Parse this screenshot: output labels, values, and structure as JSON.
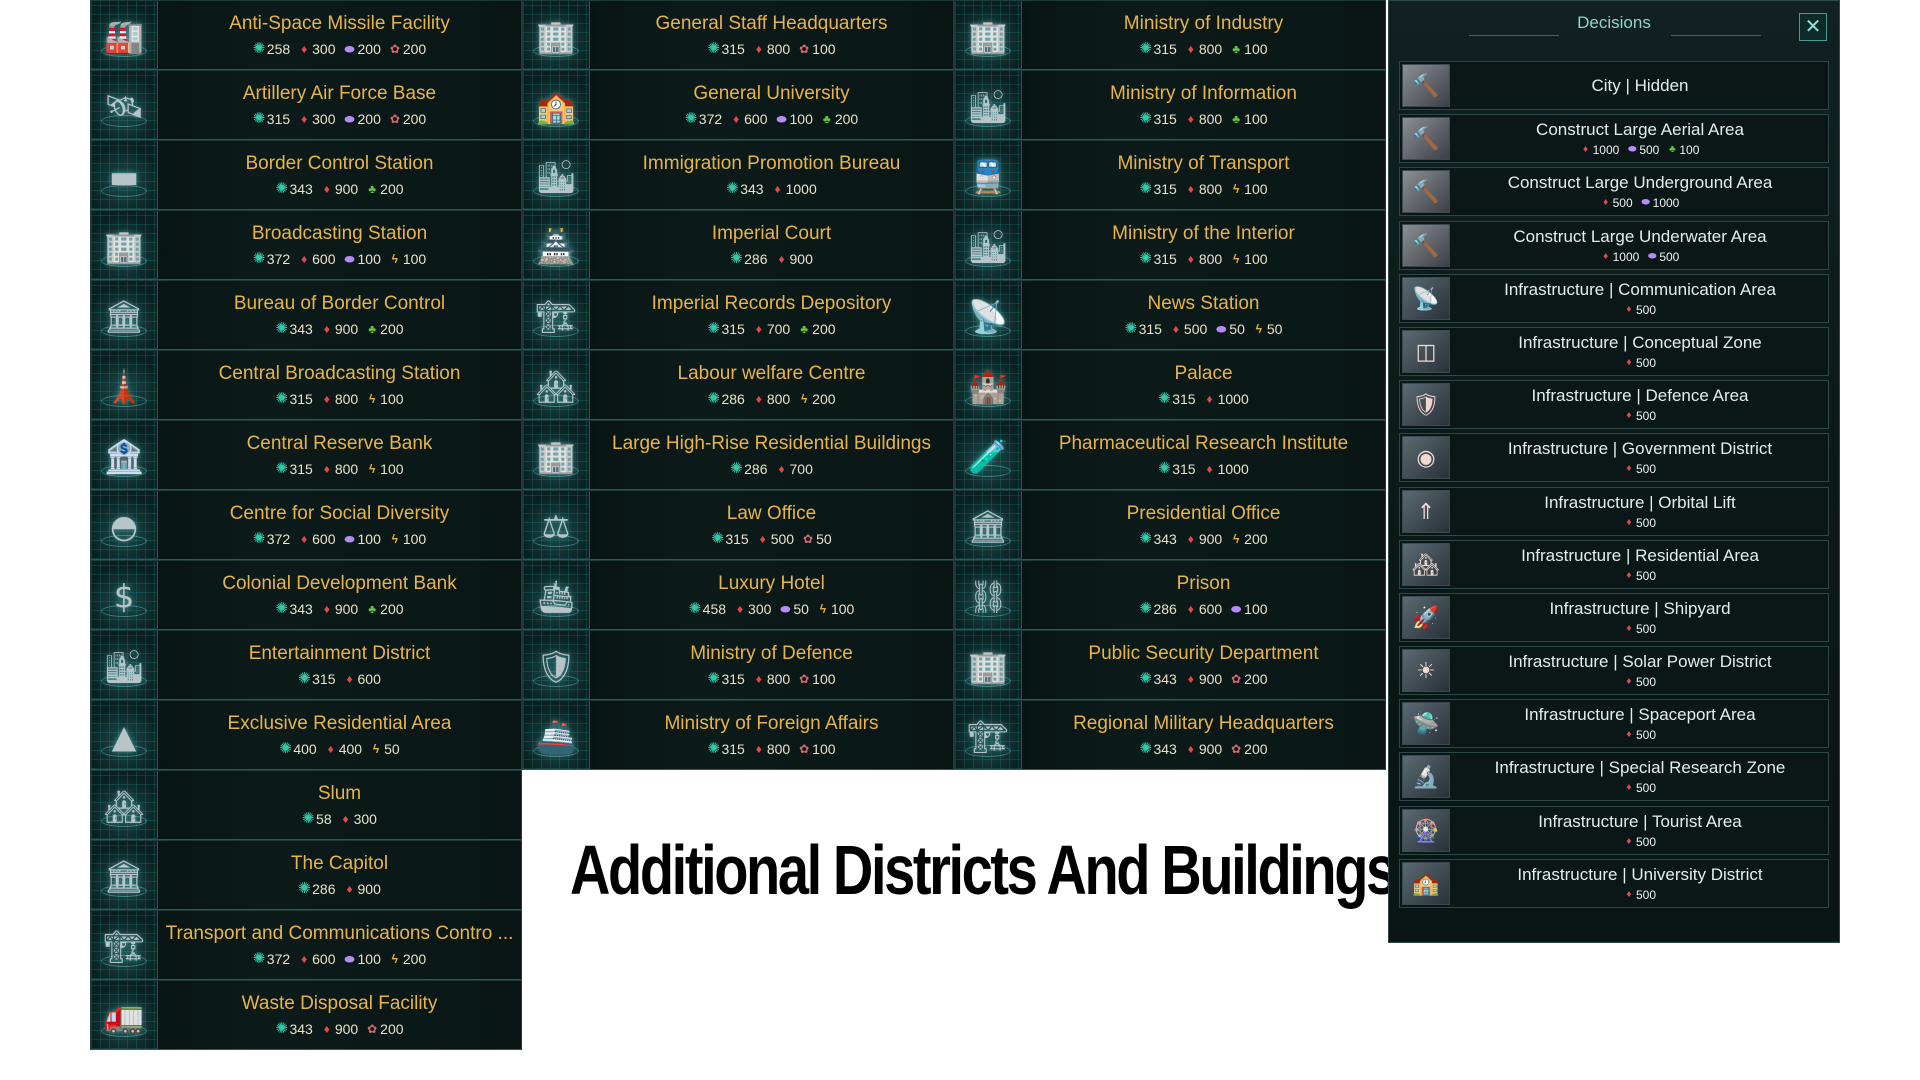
{
  "caption": "Additional Districts And Buildings [JP]",
  "icons": {
    "time": "✺",
    "minerals": "♦",
    "alloys": "⬬",
    "consumer": "✿",
    "food": "♣",
    "energy": "ϟ"
  },
  "columns": [
    [
      {
        "name": "Anti-Space Missile Facility",
        "icon": "factory-icon",
        "glyph": "🏭",
        "costs": [
          [
            "time",
            "258"
          ],
          [
            "minerals",
            "300"
          ],
          [
            "alloys",
            "200"
          ],
          [
            "consumer",
            "200"
          ]
        ]
      },
      {
        "name": "Artillery Air Force Base",
        "icon": "base-icon",
        "glyph": "🛰",
        "costs": [
          [
            "time",
            "315"
          ],
          [
            "minerals",
            "300"
          ],
          [
            "alloys",
            "200"
          ],
          [
            "consumer",
            "200"
          ]
        ]
      },
      {
        "name": "Border Control Station",
        "icon": "station-icon",
        "glyph": "▬",
        "costs": [
          [
            "time",
            "343"
          ],
          [
            "minerals",
            "900"
          ],
          [
            "food",
            "200"
          ]
        ]
      },
      {
        "name": "Broadcasting Station",
        "icon": "broadcast-icon",
        "glyph": "🏢",
        "costs": [
          [
            "time",
            "372"
          ],
          [
            "minerals",
            "600"
          ],
          [
            "alloys",
            "100"
          ],
          [
            "energy",
            "100"
          ]
        ]
      },
      {
        "name": "Bureau of Border Control",
        "icon": "bureau-icon",
        "glyph": "🏛",
        "costs": [
          [
            "time",
            "343"
          ],
          [
            "minerals",
            "900"
          ],
          [
            "food",
            "200"
          ]
        ]
      },
      {
        "name": "Central Broadcasting Station",
        "icon": "tower-icon",
        "glyph": "🗼",
        "costs": [
          [
            "time",
            "315"
          ],
          [
            "minerals",
            "800"
          ],
          [
            "energy",
            "100"
          ]
        ]
      },
      {
        "name": "Central Reserve Bank",
        "icon": "bank-icon",
        "glyph": "🏦",
        "costs": [
          [
            "time",
            "315"
          ],
          [
            "minerals",
            "800"
          ],
          [
            "energy",
            "100"
          ]
        ]
      },
      {
        "name": "Centre for Social Diversity",
        "icon": "dome-icon",
        "glyph": "◓",
        "costs": [
          [
            "time",
            "372"
          ],
          [
            "minerals",
            "600"
          ],
          [
            "alloys",
            "100"
          ],
          [
            "energy",
            "100"
          ]
        ]
      },
      {
        "name": "Colonial Development Bank",
        "icon": "dollar-icon",
        "glyph": "$",
        "costs": [
          [
            "time",
            "343"
          ],
          [
            "minerals",
            "900"
          ],
          [
            "food",
            "200"
          ]
        ]
      },
      {
        "name": "Entertainment District",
        "icon": "city-icon",
        "glyph": "🏙",
        "costs": [
          [
            "time",
            "315"
          ],
          [
            "minerals",
            "600"
          ]
        ]
      },
      {
        "name": "Exclusive Residential Area",
        "icon": "towers-icon",
        "glyph": "▲",
        "costs": [
          [
            "time",
            "400"
          ],
          [
            "minerals",
            "400"
          ],
          [
            "energy",
            "50"
          ]
        ]
      },
      {
        "name": "Slum",
        "icon": "slum-icon",
        "glyph": "🏘",
        "costs": [
          [
            "time",
            "58"
          ],
          [
            "minerals",
            "300"
          ]
        ]
      },
      {
        "name": "The Capitol",
        "icon": "capitol-icon",
        "glyph": "🏛",
        "costs": [
          [
            "time",
            "286"
          ],
          [
            "minerals",
            "900"
          ]
        ]
      },
      {
        "name": "Transport and Communications Contro ...",
        "icon": "transport-icon",
        "glyph": "🏗",
        "costs": [
          [
            "time",
            "372"
          ],
          [
            "minerals",
            "600"
          ],
          [
            "alloys",
            "100"
          ],
          [
            "energy",
            "200"
          ]
        ]
      },
      {
        "name": "Waste Disposal Facility",
        "icon": "waste-icon",
        "glyph": "🚛",
        "costs": [
          [
            "time",
            "343"
          ],
          [
            "minerals",
            "900"
          ],
          [
            "consumer",
            "200"
          ]
        ]
      }
    ],
    [
      {
        "name": "General Staff Headquarters",
        "icon": "hq-icon",
        "glyph": "🏢",
        "costs": [
          [
            "time",
            "315"
          ],
          [
            "minerals",
            "800"
          ],
          [
            "consumer",
            "100"
          ]
        ]
      },
      {
        "name": "General University",
        "icon": "university-icon",
        "glyph": "🏫",
        "costs": [
          [
            "time",
            "372"
          ],
          [
            "minerals",
            "600"
          ],
          [
            "alloys",
            "100"
          ],
          [
            "food",
            "200"
          ]
        ]
      },
      {
        "name": "Immigration Promotion Bureau",
        "icon": "bureau-icon",
        "glyph": "🏙",
        "costs": [
          [
            "time",
            "343"
          ],
          [
            "minerals",
            "1000"
          ]
        ]
      },
      {
        "name": "Imperial Court",
        "icon": "court-icon",
        "glyph": "🏯",
        "costs": [
          [
            "time",
            "286"
          ],
          [
            "minerals",
            "900"
          ]
        ]
      },
      {
        "name": "Imperial Records Depository",
        "icon": "depository-icon",
        "glyph": "🏗",
        "costs": [
          [
            "time",
            "315"
          ],
          [
            "minerals",
            "700"
          ],
          [
            "food",
            "200"
          ]
        ]
      },
      {
        "name": "Labour welfare Centre",
        "icon": "welfare-icon",
        "glyph": "🏘",
        "costs": [
          [
            "time",
            "286"
          ],
          [
            "minerals",
            "800"
          ],
          [
            "energy",
            "200"
          ]
        ]
      },
      {
        "name": "Large High-Rise Residential Buildings",
        "icon": "highrise-icon",
        "glyph": "🏢",
        "costs": [
          [
            "time",
            "286"
          ],
          [
            "minerals",
            "700"
          ]
        ]
      },
      {
        "name": "Law Office",
        "icon": "law-icon",
        "glyph": "⚖",
        "costs": [
          [
            "time",
            "315"
          ],
          [
            "minerals",
            "500"
          ],
          [
            "consumer",
            "50"
          ]
        ]
      },
      {
        "name": "Luxury Hotel",
        "icon": "hotel-icon",
        "glyph": "🛳",
        "costs": [
          [
            "time",
            "458"
          ],
          [
            "minerals",
            "300"
          ],
          [
            "alloys",
            "50"
          ],
          [
            "energy",
            "100"
          ]
        ]
      },
      {
        "name": "Ministry of Defence",
        "icon": "defence-icon",
        "glyph": "🛡",
        "costs": [
          [
            "time",
            "315"
          ],
          [
            "minerals",
            "800"
          ],
          [
            "consumer",
            "100"
          ]
        ]
      },
      {
        "name": "Ministry of Foreign Affairs",
        "icon": "foreign-icon",
        "glyph": "🚢",
        "costs": [
          [
            "time",
            "315"
          ],
          [
            "minerals",
            "800"
          ],
          [
            "consumer",
            "100"
          ]
        ]
      }
    ],
    [
      {
        "name": "Ministry of Industry",
        "icon": "industry-icon",
        "glyph": "🏢",
        "costs": [
          [
            "time",
            "315"
          ],
          [
            "minerals",
            "800"
          ],
          [
            "food",
            "100"
          ]
        ]
      },
      {
        "name": "Ministry of Information",
        "icon": "information-icon",
        "glyph": "🏙",
        "costs": [
          [
            "time",
            "315"
          ],
          [
            "minerals",
            "800"
          ],
          [
            "food",
            "100"
          ]
        ]
      },
      {
        "name": "Ministry of Transport",
        "icon": "transport-icon",
        "glyph": "🚆",
        "costs": [
          [
            "time",
            "315"
          ],
          [
            "minerals",
            "800"
          ],
          [
            "energy",
            "100"
          ]
        ]
      },
      {
        "name": "Ministry of the Interior",
        "icon": "interior-icon",
        "glyph": "🏙",
        "costs": [
          [
            "time",
            "315"
          ],
          [
            "minerals",
            "800"
          ],
          [
            "energy",
            "100"
          ]
        ]
      },
      {
        "name": "News Station",
        "icon": "news-icon",
        "glyph": "📡",
        "costs": [
          [
            "time",
            "315"
          ],
          [
            "minerals",
            "500"
          ],
          [
            "alloys",
            "50"
          ],
          [
            "energy",
            "50"
          ]
        ]
      },
      {
        "name": "Palace",
        "icon": "palace-icon",
        "glyph": "🏰",
        "costs": [
          [
            "time",
            "315"
          ],
          [
            "minerals",
            "1000"
          ]
        ]
      },
      {
        "name": "Pharmaceutical Research Institute",
        "icon": "lab-icon",
        "glyph": "🧪",
        "costs": [
          [
            "time",
            "315"
          ],
          [
            "minerals",
            "1000"
          ]
        ]
      },
      {
        "name": "Presidential Office",
        "icon": "office-icon",
        "glyph": "🏛",
        "costs": [
          [
            "time",
            "343"
          ],
          [
            "minerals",
            "900"
          ],
          [
            "energy",
            "200"
          ]
        ]
      },
      {
        "name": "Prison",
        "icon": "prison-icon",
        "glyph": "⛓",
        "costs": [
          [
            "time",
            "286"
          ],
          [
            "minerals",
            "600"
          ],
          [
            "alloys",
            "100"
          ]
        ]
      },
      {
        "name": "Public Security Department",
        "icon": "security-icon",
        "glyph": "🏢",
        "costs": [
          [
            "time",
            "343"
          ],
          [
            "minerals",
            "900"
          ],
          [
            "consumer",
            "200"
          ]
        ]
      },
      {
        "name": "Regional Military Headquarters",
        "icon": "military-icon",
        "glyph": "🏗",
        "costs": [
          [
            "time",
            "343"
          ],
          [
            "minerals",
            "900"
          ],
          [
            "consumer",
            "200"
          ]
        ]
      }
    ]
  ],
  "decisions": {
    "title": "Decisions",
    "close_label": "✕",
    "items": [
      {
        "name": "City  |  Hidden",
        "icon": "gavel-icon",
        "glyph": "🔨",
        "gavel": true,
        "costs": []
      },
      {
        "name": "Construct Large Aerial Area",
        "icon": "gavel-icon",
        "glyph": "🔨",
        "gavel": true,
        "costs": [
          [
            "minerals",
            "1000"
          ],
          [
            "alloys",
            "500"
          ],
          [
            "food",
            "100"
          ]
        ]
      },
      {
        "name": "Construct Large Underground Area",
        "icon": "gavel-icon",
        "glyph": "🔨",
        "gavel": true,
        "costs": [
          [
            "minerals",
            "500"
          ],
          [
            "alloys",
            "1000"
          ]
        ]
      },
      {
        "name": "Construct Large Underwater Area",
        "icon": "gavel-icon",
        "glyph": "🔨",
        "gavel": true,
        "costs": [
          [
            "minerals",
            "1000"
          ],
          [
            "alloys",
            "500"
          ]
        ]
      },
      {
        "name": "Infrastructure | Communication Area",
        "icon": "communication-icon",
        "glyph": "📡",
        "costs": [
          [
            "minerals",
            "500"
          ]
        ]
      },
      {
        "name": "Infrastructure | Conceptual Zone",
        "icon": "conceptual-icon",
        "glyph": "◫",
        "costs": [
          [
            "minerals",
            "500"
          ]
        ]
      },
      {
        "name": "Infrastructure | Defence Area",
        "icon": "defence-icon",
        "glyph": "🛡",
        "costs": [
          [
            "minerals",
            "500"
          ]
        ]
      },
      {
        "name": "Infrastructure | Government District",
        "icon": "government-icon",
        "glyph": "◉",
        "costs": [
          [
            "minerals",
            "500"
          ]
        ]
      },
      {
        "name": "Infrastructure | Orbital Lift",
        "icon": "orbital-lift-icon",
        "glyph": "⇑",
        "costs": [
          [
            "minerals",
            "500"
          ]
        ]
      },
      {
        "name": "Infrastructure | Residential Area",
        "icon": "residential-icon",
        "glyph": "🏘",
        "costs": [
          [
            "minerals",
            "500"
          ]
        ]
      },
      {
        "name": "Infrastructure | Shipyard",
        "icon": "shipyard-icon",
        "glyph": "🚀",
        "costs": [
          [
            "minerals",
            "500"
          ]
        ]
      },
      {
        "name": "Infrastructure | Solar Power District",
        "icon": "solar-icon",
        "glyph": "☀",
        "costs": [
          [
            "minerals",
            "500"
          ]
        ]
      },
      {
        "name": "Infrastructure | Spaceport Area",
        "icon": "spaceport-icon",
        "glyph": "🛸",
        "costs": [
          [
            "minerals",
            "500"
          ]
        ]
      },
      {
        "name": "Infrastructure | Special Research Zone",
        "icon": "research-icon",
        "glyph": "🔬",
        "costs": [
          [
            "minerals",
            "500"
          ]
        ]
      },
      {
        "name": "Infrastructure | Tourist Area",
        "icon": "tourist-icon",
        "glyph": "🎡",
        "costs": [
          [
            "minerals",
            "500"
          ]
        ]
      },
      {
        "name": "Infrastructure | University District",
        "icon": "university-icon",
        "glyph": "🏫",
        "costs": [
          [
            "minerals",
            "500"
          ]
        ]
      }
    ]
  }
}
